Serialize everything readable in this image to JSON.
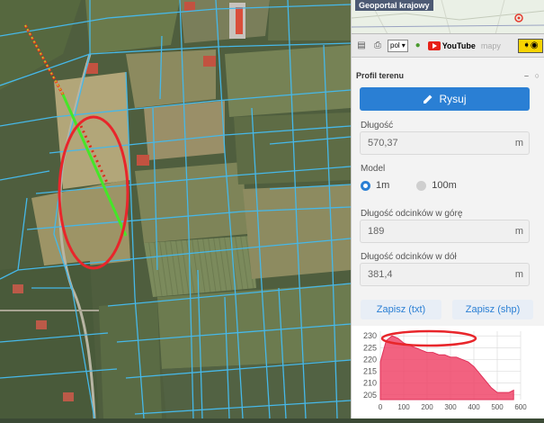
{
  "app": {
    "minimap_title": "Geoportal krajowy",
    "language": "pol",
    "youtube_label": "YouTube",
    "mapy_label": "mapy"
  },
  "profil": {
    "title": "Profil terenu",
    "rysuj_label": "Rysuj",
    "dlugosc_label": "Długość",
    "dlugosc_value": "570,37",
    "dlugosc_unit": "m",
    "model_label": "Model",
    "model_options": [
      "1m",
      "100m"
    ],
    "model_selected": "1m",
    "gora_label": "Długość odcinków w górę",
    "gora_value": "189",
    "gora_unit": "m",
    "dol_label": "Długość odcinków w dół",
    "dol_value": "381,4",
    "dol_unit": "m",
    "zapisz_txt": "Zapisz (txt)",
    "zapisz_shp": "Zapisz (shp)"
  },
  "colors": {
    "accent": "#2a7fd4",
    "profile_fill": "#f0476a",
    "annotation": "#e8262b",
    "parcel_line": "#46b8e8"
  },
  "chart_data": {
    "type": "area",
    "x": [
      0,
      25,
      50,
      75,
      100,
      125,
      150,
      175,
      200,
      225,
      250,
      275,
      300,
      325,
      350,
      375,
      400,
      425,
      450,
      475,
      500,
      525,
      550,
      570
    ],
    "y": [
      219,
      228,
      230,
      229,
      227,
      226,
      225,
      224,
      223,
      223,
      222,
      222,
      221,
      221,
      220,
      219,
      217,
      214,
      211,
      208,
      206,
      206,
      206,
      207
    ],
    "xlim": [
      0,
      600
    ],
    "ylim": [
      203,
      232
    ],
    "xticks": [
      0,
      100,
      200,
      300,
      400,
      500,
      600
    ],
    "yticks": [
      205,
      210,
      215,
      220,
      225,
      230
    ],
    "grid": true
  }
}
